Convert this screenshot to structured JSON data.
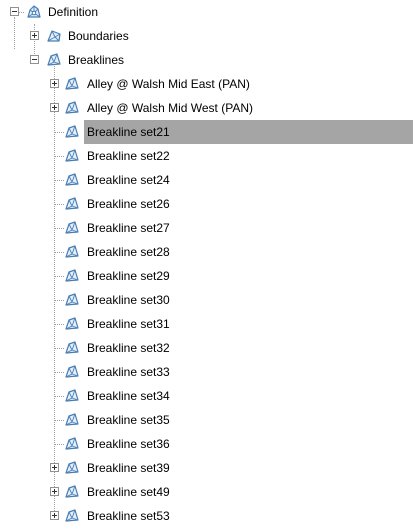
{
  "tree": {
    "root": {
      "label": "Definition",
      "expanded": true,
      "icon": "definition-icon"
    },
    "children": [
      {
        "label": "Boundaries",
        "expanded": false,
        "icon": "boundary-icon",
        "has_children": true
      },
      {
        "label": "Breaklines",
        "expanded": true,
        "icon": "breakline-icon",
        "has_children": true,
        "items": [
          {
            "label": "Alley @ Walsh Mid East (PAN)",
            "has_children": true,
            "selected": false
          },
          {
            "label": "Alley @ Walsh Mid West (PAN)",
            "has_children": true,
            "selected": false
          },
          {
            "label": "Breakline set21",
            "has_children": false,
            "selected": true
          },
          {
            "label": "Breakline set22",
            "has_children": false,
            "selected": false
          },
          {
            "label": "Breakline set24",
            "has_children": false,
            "selected": false
          },
          {
            "label": "Breakline set26",
            "has_children": false,
            "selected": false
          },
          {
            "label": "Breakline set27",
            "has_children": false,
            "selected": false
          },
          {
            "label": "Breakline set28",
            "has_children": false,
            "selected": false
          },
          {
            "label": "Breakline set29",
            "has_children": false,
            "selected": false
          },
          {
            "label": "Breakline set30",
            "has_children": false,
            "selected": false
          },
          {
            "label": "Breakline set31",
            "has_children": false,
            "selected": false
          },
          {
            "label": "Breakline set32",
            "has_children": false,
            "selected": false
          },
          {
            "label": "Breakline set33",
            "has_children": false,
            "selected": false
          },
          {
            "label": "Breakline set34",
            "has_children": false,
            "selected": false
          },
          {
            "label": "Breakline set35",
            "has_children": false,
            "selected": false
          },
          {
            "label": "Breakline set36",
            "has_children": false,
            "selected": false
          },
          {
            "label": "Breakline set39",
            "has_children": true,
            "selected": false
          },
          {
            "label": "Breakline set49",
            "has_children": true,
            "selected": false
          },
          {
            "label": "Breakline set53",
            "has_children": true,
            "selected": false
          }
        ]
      }
    ]
  },
  "colors": {
    "selection": "#a5a5a5",
    "tree_lines": "#a0a0a0",
    "icon_stroke": "#4a7fb5",
    "icon_fill": "#e3eef9"
  }
}
